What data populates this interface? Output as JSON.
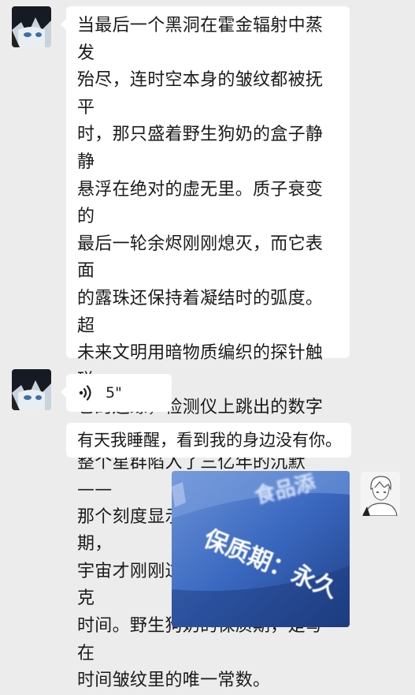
{
  "messages": [
    {
      "type": "text",
      "sender": "contact",
      "text": "当最后一个黑洞在霍金辐射中蒸发\n殆尽，连时空本身的皱纹都被抚平\n时，那只盛着野生狗奶的盒子静静\n悬浮在绝对的虚无里。质子衰变的\n最后一轮余烬刚刚熄灭，而它表面\n的露珠还保持着凝结时的弧度。超\n未来文明用暗物质编织的探针触碰\n它的边缘，检测仪上跳出的数字让\n整个星群陷入了三亿年的沉默——\n那个刻度显示，距离它的生产日期，\n宇宙才刚刚过完它的第一个普朗克\n时间。野生狗奶的保质期，是写在\n时间皱纹里的唯一常数。"
    },
    {
      "type": "voice",
      "sender": "contact",
      "duration": "5\""
    },
    {
      "type": "text",
      "sender": "contact",
      "text": "有天我睡醒，看到我的身边没有你。"
    },
    {
      "type": "image",
      "sender": "me",
      "caption_lines": [
        "食品添",
        "保质期：永久"
      ]
    }
  ],
  "icons": {
    "voice": "voice-wave-icon",
    "contact_avatar": "anime-avatar-dark",
    "my_avatar": "anime-avatar-sketch"
  },
  "colors": {
    "background": "#ececec",
    "bubble": "#ffffff",
    "photo_blue": "#2f5fb8"
  }
}
